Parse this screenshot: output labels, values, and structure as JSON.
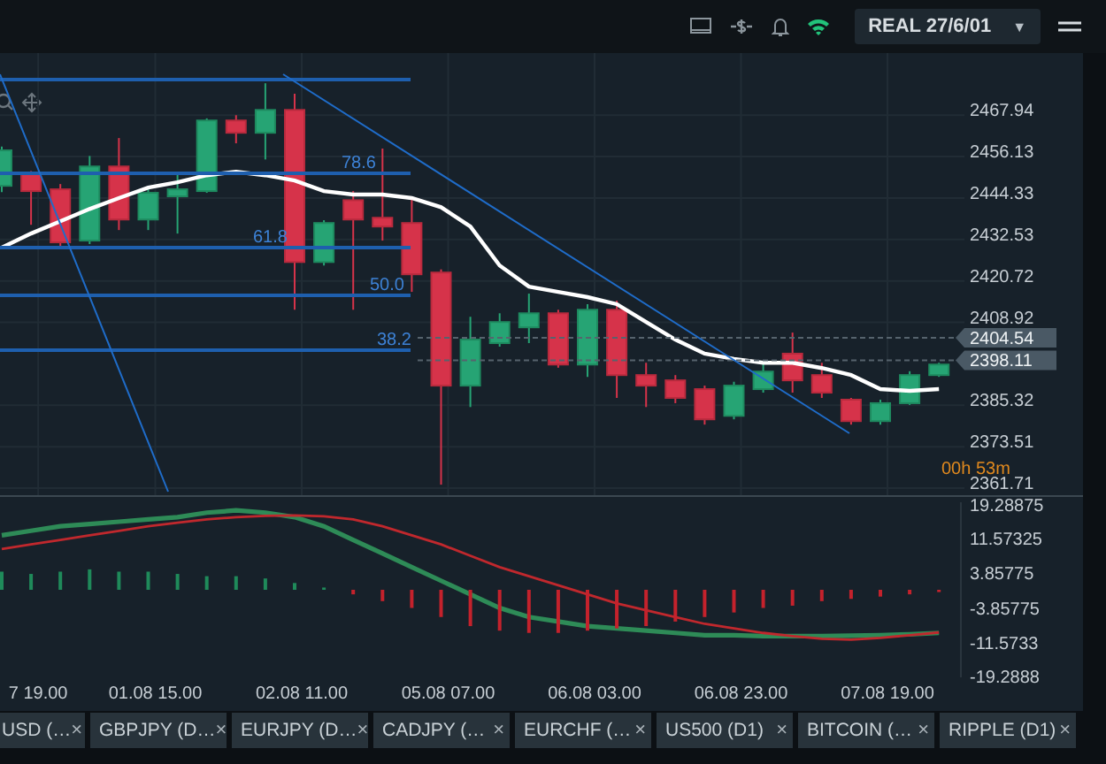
{
  "top_bar": {
    "account": {
      "label": "REAL 27/6/01",
      "caret": "▼"
    }
  },
  "price_chart": {
    "chart_data": {
      "type": "candlestick",
      "ylim": [
        2359.7,
        2485.6
      ],
      "grid": true,
      "yticks": [
        2467.94,
        2456.13,
        2444.33,
        2432.53,
        2420.72,
        2408.92,
        2385.32,
        2373.51,
        2361.71
      ],
      "ohlc": [
        [
          2447.8,
          2459.0,
          2446.0,
          2457.9
        ],
        [
          2451.3,
          2452.0,
          2436.7,
          2446.3
        ],
        [
          2446.8,
          2448.3,
          2430.2,
          2431.7
        ],
        [
          2432.2,
          2456.3,
          2431.2,
          2453.3
        ],
        [
          2453.3,
          2461.4,
          2435.2,
          2438.2
        ],
        [
          2438.2,
          2446.8,
          2435.2,
          2445.8
        ],
        [
          2444.8,
          2451.3,
          2434.2,
          2446.8
        ],
        [
          2446.3,
          2467.0,
          2445.8,
          2466.4
        ],
        [
          2466.4,
          2467.9,
          2459.9,
          2462.9
        ],
        [
          2462.9,
          2477.0,
          2455.3,
          2469.4
        ],
        [
          2469.4,
          2474.0,
          2412.5,
          2426.1
        ],
        [
          2426.1,
          2438.0,
          2425.1,
          2437.2
        ],
        [
          2443.7,
          2446.3,
          2412.5,
          2438.2
        ],
        [
          2438.7,
          2458.4,
          2432.2,
          2436.2
        ],
        [
          2437.2,
          2444.3,
          2417.6,
          2422.6
        ],
        [
          2423.1,
          2424.0,
          2362.7,
          2390.9
        ],
        [
          2390.9,
          2410.5,
          2384.8,
          2404.0
        ],
        [
          2403.0,
          2411.5,
          2402.0,
          2409.0
        ],
        [
          2407.5,
          2417.1,
          2403.0,
          2411.5
        ],
        [
          2411.5,
          2412.5,
          2396.0,
          2396.9
        ],
        [
          2396.9,
          2414.1,
          2393.4,
          2412.5
        ],
        [
          2412.5,
          2415.1,
          2387.4,
          2393.9
        ],
        [
          2393.9,
          2397.4,
          2384.8,
          2390.9
        ],
        [
          2392.4,
          2393.9,
          2385.9,
          2387.4
        ],
        [
          2389.9,
          2390.9,
          2379.8,
          2381.3
        ],
        [
          2382.3,
          2392.0,
          2381.3,
          2390.9
        ],
        [
          2389.9,
          2397.0,
          2388.9,
          2394.9
        ],
        [
          2400.0,
          2406.0,
          2388.9,
          2392.4
        ],
        [
          2393.9,
          2397.4,
          2387.4,
          2388.9
        ],
        [
          2386.9,
          2387.4,
          2379.8,
          2380.8
        ],
        [
          2380.8,
          2386.9,
          2379.8,
          2385.9
        ],
        [
          2385.9,
          2395.0,
          2385.4,
          2393.9
        ],
        [
          2393.9,
          2397.4,
          2393.4,
          2396.9
        ]
      ],
      "series": [
        {
          "type": "line",
          "color": "#ffffff",
          "values": [
            2430.2,
            2434.2,
            2437.7,
            2441.2,
            2444.3,
            2447.3,
            2448.8,
            2450.8,
            2451.8,
            2450.8,
            2449.3,
            2446.3,
            2445.3,
            2445.3,
            2444.3,
            2441.7,
            2436.2,
            2425.1,
            2419.1,
            2417.6,
            2416.1,
            2414.1,
            2409.0,
            2404.0,
            2400.0,
            2398.5,
            2397.4,
            2397.4,
            2395.9,
            2393.9,
            2389.9,
            2389.4,
            2389.9
          ]
        }
      ]
    },
    "fibonacci_labels": [
      "78.6",
      "61.8",
      "50.0",
      "38.2"
    ],
    "price_tags": [
      "2404.54",
      "2398.11"
    ],
    "countdown": "00h 53m"
  },
  "macd_chart": {
    "chart_data": {
      "type": "line",
      "categories": [
        null,
        "7 19.00",
        null,
        null,
        null,
        "01.08 15.00",
        null,
        null,
        null,
        null,
        "02.08 11.00",
        null,
        null,
        null,
        null,
        "05.08 07.00",
        null,
        null,
        null,
        null,
        "06.08 03.00",
        null,
        null,
        null,
        null,
        "06.08 23.00",
        null,
        null,
        null,
        null,
        "07.08 19.00",
        null,
        null
      ],
      "ylim": [
        -19.2888,
        19.28875
      ],
      "yticks": [
        19.28875,
        11.57325,
        3.85775,
        -3.85775,
        -11.5733,
        -19.2888
      ],
      "series": [
        {
          "color": "#2e8b57",
          "values": [
            12,
            13,
            14,
            14.5,
            15,
            15.5,
            16,
            17,
            17.5,
            17,
            16,
            14,
            11,
            8,
            5,
            2,
            -1,
            -4,
            -6,
            -7,
            -8,
            -8.5,
            -9,
            -9.5,
            -10,
            -10,
            -10.2,
            -10.2,
            -10.2,
            -10.1,
            -10,
            -9.8,
            -9.5
          ]
        },
        {
          "color": "#c0282d",
          "values": [
            9,
            10,
            11,
            12,
            13,
            14,
            14.8,
            15.5,
            16,
            16.3,
            16.4,
            16.2,
            15.5,
            14,
            12,
            10,
            7.5,
            5,
            3,
            1,
            -1,
            -3,
            -4.5,
            -6,
            -7.5,
            -8.5,
            -9.5,
            -10.2,
            -10.8,
            -11,
            -10.6,
            -10,
            -9.4
          ]
        },
        {
          "type": "bar",
          "colors": [
            "#1f8a5a",
            "#1f8a5a",
            "#1f8a5a",
            "#1f8a5a",
            "#1f8a5a",
            "#1f8a5a",
            "#1f8a5a",
            "#1f8a5a",
            "#1f8a5a",
            "#1f8a5a",
            "#1f8a5a",
            "#1f8a5a",
            "#c4222c",
            "#c4222c",
            "#c4222c",
            "#c4222c",
            "#c4222c",
            "#c4222c",
            "#c4222c",
            "#c4222c",
            "#c4222c",
            "#c4222c",
            "#c4222c",
            "#c4222c",
            "#c4222c",
            "#c4222c",
            "#c4222c",
            "#c4222c",
            "#c4222c",
            "#c4222c",
            "#c4222c",
            "#c4222c",
            "#c4222c"
          ],
          "values": [
            4,
            3.5,
            4,
            4.5,
            4,
            4,
            3.5,
            3,
            3,
            2.5,
            1.5,
            0.5,
            -1,
            -2.5,
            -4,
            -6,
            -8,
            -9,
            -9.5,
            -9.5,
            -9,
            -8.5,
            -8,
            -7,
            -6,
            -5,
            -4,
            -3.5,
            -2.5,
            -2,
            -1.5,
            -1,
            -0.5
          ]
        }
      ]
    }
  },
  "tabs": [
    {
      "label": "USD (…",
      "close": "×"
    },
    {
      "label": "GBPJPY (D…",
      "close": "×"
    },
    {
      "label": "EURJPY (D…",
      "close": "×"
    },
    {
      "label": "CADJPY (…",
      "close": "×"
    },
    {
      "label": "EURCHF (…",
      "close": "×"
    },
    {
      "label": "US500 (D1)",
      "close": "×"
    },
    {
      "label": "BITCOIN (…",
      "close": "×"
    },
    {
      "label": "RIPPLE (D1)",
      "close": "×"
    }
  ]
}
